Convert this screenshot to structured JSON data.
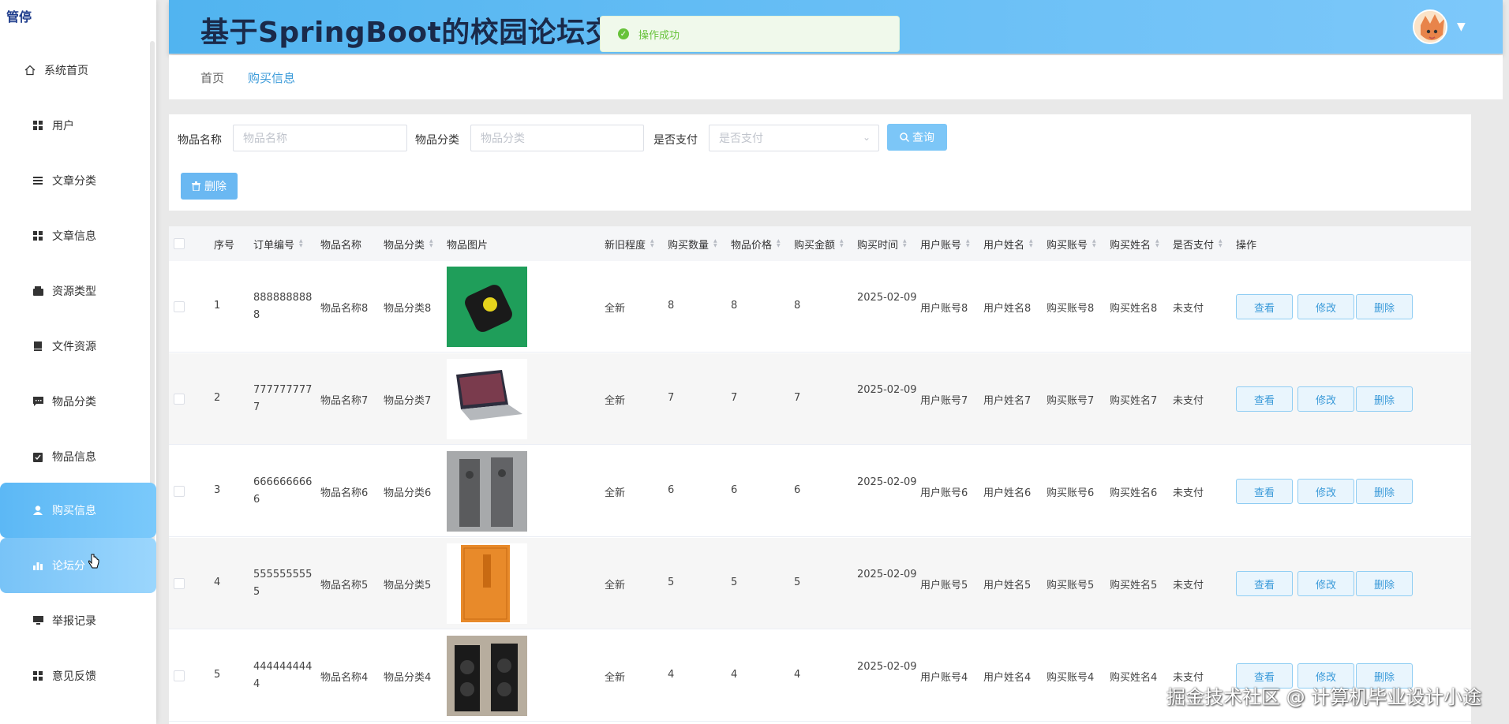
{
  "brand": "管停",
  "header": {
    "title": "基于SpringBoot的校园论坛交流系统"
  },
  "toast": {
    "message": "操作成功"
  },
  "sidebar": {
    "items": [
      {
        "label": "系统首页",
        "icon": "home-icon"
      },
      {
        "label": "用户",
        "icon": "grid-icon"
      },
      {
        "label": "文章分类",
        "icon": "list-icon"
      },
      {
        "label": "文章信息",
        "icon": "grid-icon"
      },
      {
        "label": "资源类型",
        "icon": "wallet-icon"
      },
      {
        "label": "文件资源",
        "icon": "book-icon"
      },
      {
        "label": "物品分类",
        "icon": "message-icon"
      },
      {
        "label": "物品信息",
        "icon": "clipboard-icon"
      },
      {
        "label": "购买信息",
        "icon": "user-icon"
      },
      {
        "label": "论坛分",
        "icon": "chart-icon"
      },
      {
        "label": "举报记录",
        "icon": "monitor-icon"
      },
      {
        "label": "意见反馈",
        "icon": "grid-icon"
      }
    ]
  },
  "breadcrumb": {
    "home": "首页",
    "current": "购买信息"
  },
  "search": {
    "name_label": "物品名称",
    "name_placeholder": "物品名称",
    "category_label": "物品分类",
    "category_placeholder": "物品分类",
    "paid_label": "是否支付",
    "paid_placeholder": "是否支付",
    "query_button": "查询",
    "delete_button": "删除"
  },
  "table": {
    "headers": [
      "序号",
      "订单编号",
      "物品名称",
      "物品分类",
      "物品图片",
      "新旧程度",
      "购买数量",
      "物品价格",
      "购买金额",
      "购买时间",
      "用户账号",
      "用户姓名",
      "购买账号",
      "购买姓名",
      "是否支付",
      "操作"
    ],
    "actions": {
      "view": "查看",
      "edit": "修改",
      "delete": "删除"
    },
    "rows": [
      {
        "no": "1",
        "order": "8888888888",
        "name": "物品名称8",
        "cat": "物品分类8",
        "cond": "全新",
        "qty": "8",
        "price": "8",
        "amount": "8",
        "time": "2025-02-09",
        "uacc": "用户账号8",
        "uname": "用户姓名8",
        "bacc": "购买账号8",
        "bname": "购买姓名8",
        "paid": "未支付",
        "img": "phone"
      },
      {
        "no": "2",
        "order": "7777777777",
        "name": "物品名称7",
        "cat": "物品分类7",
        "cond": "全新",
        "qty": "7",
        "price": "7",
        "amount": "7",
        "time": "2025-02-09",
        "uacc": "用户账号7",
        "uname": "用户姓名7",
        "bacc": "购买账号7",
        "bname": "购买姓名7",
        "paid": "未支付",
        "img": "laptop"
      },
      {
        "no": "3",
        "order": "6666666666",
        "name": "物品名称6",
        "cat": "物品分类6",
        "cond": "全新",
        "qty": "6",
        "price": "6",
        "amount": "6",
        "time": "2025-02-09",
        "uacc": "用户账号6",
        "uname": "用户姓名6",
        "bacc": "购买账号6",
        "bname": "购买姓名6",
        "paid": "未支付",
        "img": "speakers"
      },
      {
        "no": "4",
        "order": "5555555555",
        "name": "物品名称5",
        "cat": "物品分类5",
        "cond": "全新",
        "qty": "5",
        "price": "5",
        "amount": "5",
        "time": "2025-02-09",
        "uacc": "用户账号5",
        "uname": "用户姓名5",
        "bacc": "购买账号5",
        "bname": "购买姓名5",
        "paid": "未支付",
        "img": "book"
      },
      {
        "no": "5",
        "order": "4444444444",
        "name": "物品名称4",
        "cat": "物品分类4",
        "cond": "全新",
        "qty": "4",
        "price": "4",
        "amount": "4",
        "time": "2025-02-09",
        "uacc": "用户账号4",
        "uname": "用户姓名4",
        "bacc": "购买账号4",
        "bname": "购买姓名4",
        "paid": "未支付",
        "img": "tower-speaker"
      }
    ]
  },
  "watermark": "掘金技术社区 @ 计算机毕业设计小途"
}
